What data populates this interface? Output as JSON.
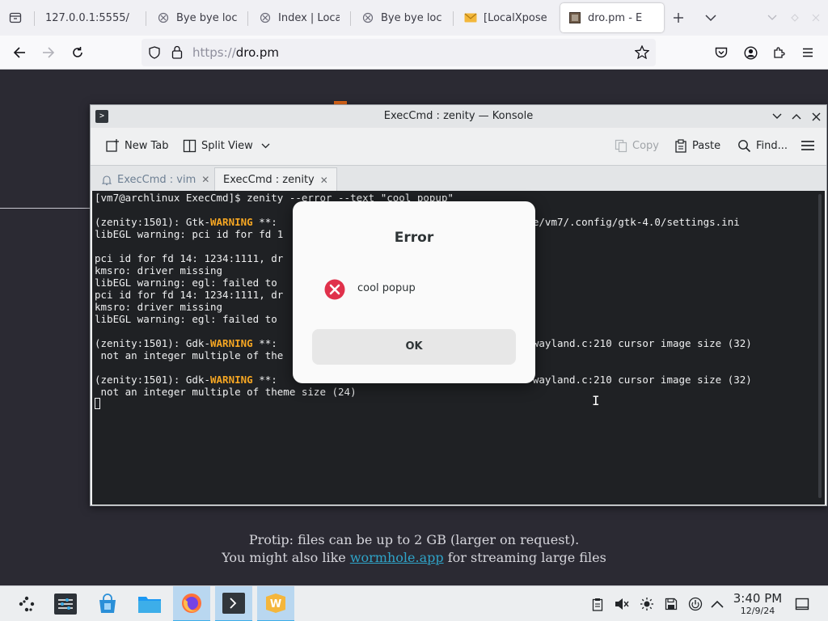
{
  "browser": {
    "tabs": [
      {
        "label": "127.0.0.1:5555/",
        "icon": "none"
      },
      {
        "label": "Bye bye local",
        "icon": "broken-link-icon"
      },
      {
        "label": "Index | Loca",
        "icon": "broken-link-icon"
      },
      {
        "label": "Bye bye local",
        "icon": "broken-link-icon"
      },
      {
        "label": "[LocalXpose",
        "icon": "mail-icon"
      },
      {
        "label": "dro.pm - E",
        "icon": "site-favicon",
        "active": true
      }
    ],
    "url": {
      "scheme": "https://",
      "host": "dro.pm"
    }
  },
  "page": {
    "protip_line1": "Protip: files can be up to 2 GB (larger on request).",
    "protip_line2_prefix": "You might also like",
    "protip_link": "wormhole.app",
    "protip_line2_suffix": "for streaming large files"
  },
  "konsole": {
    "title": "ExecCmd : zenity — Konsole",
    "toolbar": {
      "new_tab": "New Tab",
      "split_view": "Split View",
      "copy": "Copy",
      "paste": "Paste",
      "find": "Find..."
    },
    "tabs": [
      {
        "label": "ExecCmd : vim",
        "active": false
      },
      {
        "label": "ExecCmd : zenity",
        "active": true
      }
    ],
    "terminal": {
      "prompt": "[vm7@archlinux ExecCmd]$ zenity --error --text \"cool popup\"",
      "l3_a": "(zenity:1501): Gtk-",
      "l3_warn": "WARNING",
      "l3_b": " **:",
      "l3_c": "in /home/vm7/.config/gtk-4.0/settings.ini",
      "l4": "libEGL warning: pci id for fd 1",
      "l6": "pci id for fd 14: 1234:1111, dr",
      "l7": "kmsro: driver missing",
      "l8": "libEGL warning: egl: failed to",
      "l9": "pci id for fd 14: 1234:1111, dr",
      "l10": "kmsro: driver missing",
      "l11": "libEGL warning: egl: failed to",
      "l13_a": "(zenity:1501): Gdk-",
      "l13_warn": "WARNING",
      "l13_b": " **:",
      "l13_c": "cursor-wayland.c:210 cursor image size (32)",
      "l14": " not an integer multiple of the",
      "l16_a": "(zenity:1501): Gdk-",
      "l16_warn": "WARNING",
      "l16_b": " **:",
      "l16_c": "cursor-wayland.c:210 cursor image size (32)",
      "l17": " not an integer multiple of theme size (24)"
    }
  },
  "dialog": {
    "title": "Error",
    "message": "cool popup",
    "ok_label": "OK"
  },
  "taskbar": {
    "time": "3:40 PM",
    "date": "12/9/24"
  },
  "colors": {
    "accent": "#3daee9",
    "warning": "#f5a623",
    "error_icon": "#e0314b",
    "link": "#2fa4c8"
  }
}
